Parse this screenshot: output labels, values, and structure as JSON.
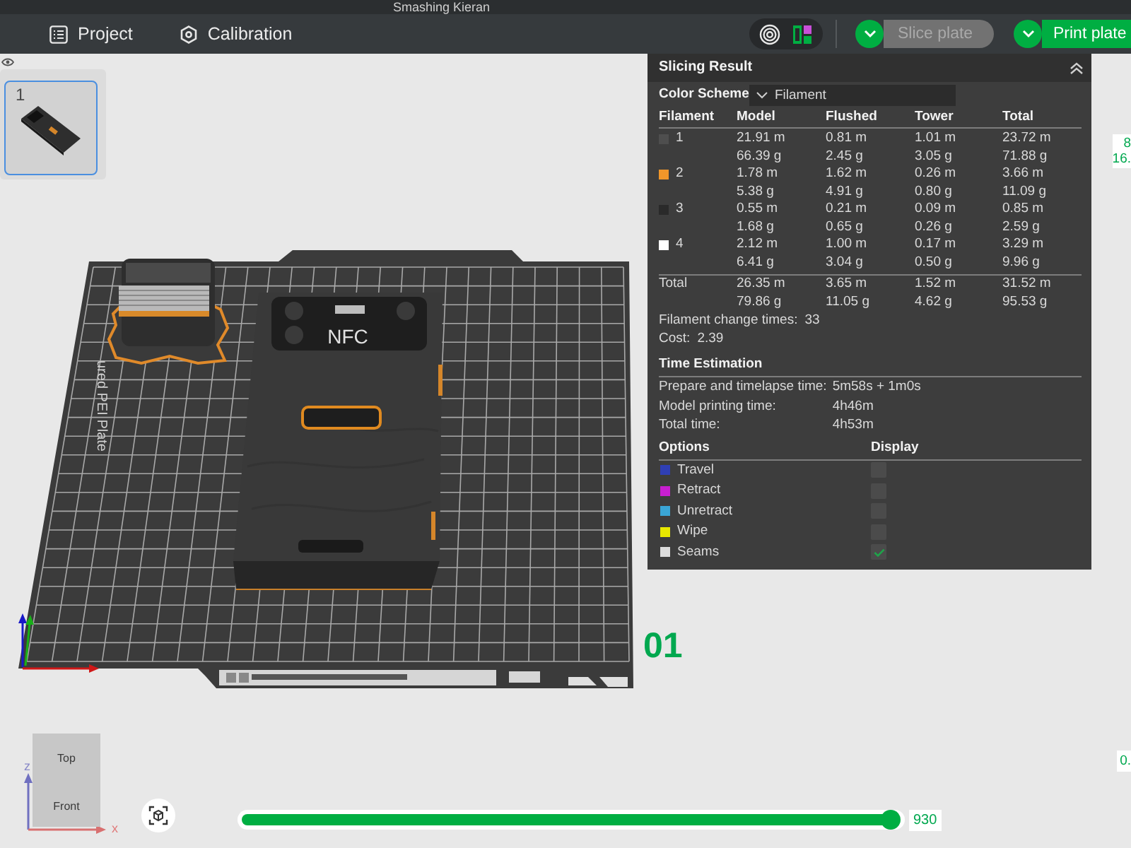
{
  "window": {
    "title": "Smashing Kieran"
  },
  "toolbar": {
    "items": [
      {
        "kind": "project",
        "label": "Project"
      },
      {
        "kind": "calibration",
        "label": "Calibration"
      }
    ],
    "slice_button": {
      "label": "Slice plate",
      "disabled": true
    },
    "print_button": {
      "label": "Print plate",
      "disabled": false
    }
  },
  "plates": [
    {
      "number": "1",
      "selected": true
    }
  ],
  "scene": {
    "plate_label": "ured PEI Plate",
    "model_label": "NFC",
    "plate_number": "01"
  },
  "slicing_result": {
    "title": "Slicing Result",
    "color_scheme": {
      "label": "Color Scheme",
      "value": "Filament"
    },
    "columns": [
      "Filament",
      "Model",
      "Flushed",
      "Tower",
      "Total"
    ],
    "filaments": [
      {
        "label": "1",
        "color": "#4e4e4e",
        "cells": [
          [
            "21.91 m",
            "66.39 g"
          ],
          [
            "0.81 m",
            "2.45 g"
          ],
          [
            "1.01 m",
            "3.05 g"
          ],
          [
            "23.72 m",
            "71.88 g"
          ]
        ]
      },
      {
        "label": "2",
        "color": "#f0962a",
        "cells": [
          [
            "1.78 m",
            "5.38 g"
          ],
          [
            "1.62 m",
            "4.91 g"
          ],
          [
            "0.26 m",
            "0.80 g"
          ],
          [
            "3.66 m",
            "11.09 g"
          ]
        ]
      },
      {
        "label": "3",
        "color": "#2a2a2a",
        "cells": [
          [
            "0.55 m",
            "1.68 g"
          ],
          [
            "0.21 m",
            "0.65 g"
          ],
          [
            "0.09 m",
            "0.26 g"
          ],
          [
            "0.85 m",
            "2.59 g"
          ]
        ]
      },
      {
        "label": "4",
        "color": "#ffffff",
        "cells": [
          [
            "2.12 m",
            "6.41 g"
          ],
          [
            "1.00 m",
            "3.04 g"
          ],
          [
            "0.17 m",
            "0.50 g"
          ],
          [
            "3.29 m",
            "9.96 g"
          ]
        ]
      }
    ],
    "total": {
      "label": "Total",
      "cells": [
        [
          "26.35 m",
          "79.86 g"
        ],
        [
          "3.65 m",
          "11.05 g"
        ],
        [
          "1.52 m",
          "4.62 g"
        ],
        [
          "31.52 m",
          "95.53 g"
        ]
      ]
    },
    "stats": [
      {
        "label": "Filament change times:",
        "value": "33"
      },
      {
        "label": "Cost:",
        "value": "2.39"
      }
    ],
    "time_estimation": {
      "title": "Time Estimation",
      "rows": [
        {
          "label": "Prepare and timelapse time:",
          "value": "5m58s + 1m0s"
        },
        {
          "label": "Model printing time:",
          "value": "4h46m"
        },
        {
          "label": "Total time:",
          "value": "4h53m"
        }
      ]
    },
    "options": {
      "columns": [
        "Options",
        "Display"
      ],
      "items": [
        {
          "label": "Travel",
          "color": "#2f3fb5",
          "checked": false
        },
        {
          "label": "Retract",
          "color": "#c81fd0",
          "checked": false
        },
        {
          "label": "Unretract",
          "color": "#3aa6d6",
          "checked": false
        },
        {
          "label": "Wipe",
          "color": "#e8e800",
          "checked": false
        },
        {
          "label": "Seams",
          "color": "#dcdcdc",
          "checked": true
        }
      ]
    }
  },
  "layer_slider": {
    "level": 1,
    "value": "930"
  },
  "vertical_slider": {
    "labels": [
      "8",
      "16."
    ],
    "bottom_label": "0."
  },
  "view_cube": {
    "faces": [
      "Top",
      "Front"
    ],
    "axes": [
      "z",
      "x"
    ]
  }
}
